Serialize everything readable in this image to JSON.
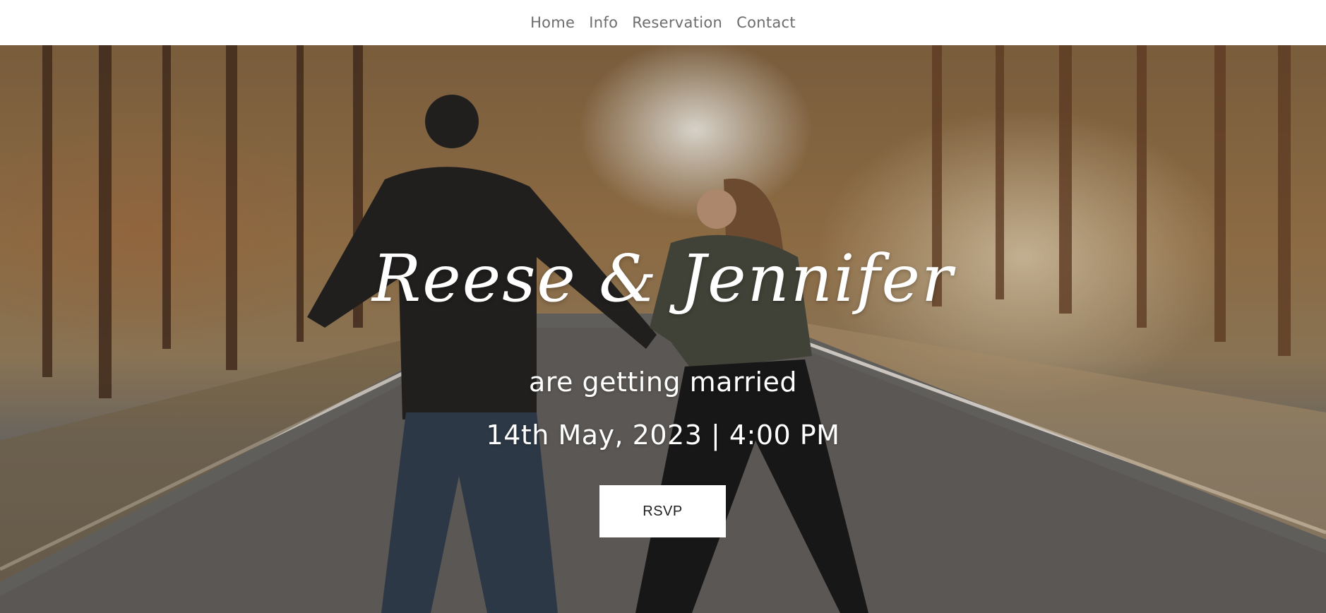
{
  "nav": {
    "items": [
      {
        "label": "Home"
      },
      {
        "label": "Info"
      },
      {
        "label": "Reservation"
      },
      {
        "label": "Contact"
      }
    ]
  },
  "hero": {
    "names": "Reese & Jennifer",
    "subtitle": "are getting married",
    "date": "14th May, 2023 | 4:00 PM",
    "rsvp_label": "RSVP"
  },
  "colors": {
    "nav_text": "#6d6d6d",
    "hero_text": "#ffffff",
    "button_bg": "#ffffff",
    "button_text": "#1e1e1e"
  }
}
